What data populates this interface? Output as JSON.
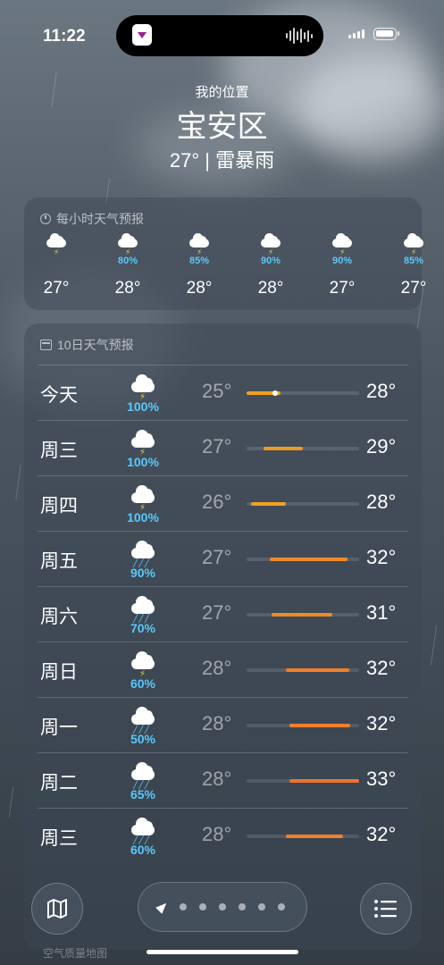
{
  "status": {
    "time": "11:22"
  },
  "header": {
    "subtitle": "我的位置",
    "location": "宝安区",
    "condition": "27° | 雷暴雨"
  },
  "hourly": {
    "title": "每小时天气预报",
    "items": [
      {
        "icon": "cloud-bolt-icon",
        "pct": "",
        "temp": "27°"
      },
      {
        "icon": "cloud-bolt-rain-icon",
        "pct": "80%",
        "temp": "28°"
      },
      {
        "icon": "cloud-bolt-rain-icon",
        "pct": "85%",
        "temp": "28°"
      },
      {
        "icon": "cloud-bolt-rain-icon",
        "pct": "90%",
        "temp": "28°"
      },
      {
        "icon": "cloud-bolt-rain-icon",
        "pct": "90%",
        "temp": "27°"
      },
      {
        "icon": "cloud-bolt-rain-icon",
        "pct": "85%",
        "temp": "27°"
      }
    ]
  },
  "daily": {
    "title": "10日天气预报",
    "days": [
      {
        "name": "今天",
        "icon": "cloud-bolt-rain-icon",
        "pct": "100%",
        "low": "25°",
        "high": "28°",
        "bar_color": "#f0a020",
        "range_start": 0.0,
        "range_end": 0.3,
        "now": 0.25
      },
      {
        "name": "周三",
        "icon": "cloud-bolt-rain-icon",
        "pct": "100%",
        "low": "27°",
        "high": "29°",
        "bar_color": "#f09a22",
        "range_start": 0.15,
        "range_end": 0.5
      },
      {
        "name": "周四",
        "icon": "cloud-bolt-rain-icon",
        "pct": "100%",
        "low": "26°",
        "high": "28°",
        "bar_color": "#f0a020",
        "range_start": 0.04,
        "range_end": 0.35
      },
      {
        "name": "周五",
        "icon": "cloud-rain-icon",
        "pct": "90%",
        "low": "27°",
        "high": "32°",
        "bar_color": "#f08a28",
        "range_start": 0.21,
        "range_end": 0.9
      },
      {
        "name": "周六",
        "icon": "cloud-rain-icon",
        "pct": "70%",
        "low": "27°",
        "high": "31°",
        "bar_color": "#f08a28",
        "range_start": 0.22,
        "range_end": 0.76
      },
      {
        "name": "周日",
        "icon": "cloud-bolt-rain-icon",
        "pct": "60%",
        "low": "28°",
        "high": "32°",
        "bar_color": "#f07f2a",
        "range_start": 0.35,
        "range_end": 0.91
      },
      {
        "name": "周一",
        "icon": "cloud-rain-icon",
        "pct": "50%",
        "low": "28°",
        "high": "32°",
        "bar_color": "#f07f2a",
        "range_start": 0.38,
        "range_end": 0.92
      },
      {
        "name": "周二",
        "icon": "cloud-rain-icon",
        "pct": "65%",
        "low": "28°",
        "high": "33°",
        "bar_color": "#f07030",
        "range_start": 0.38,
        "range_end": 1.0
      },
      {
        "name": "周三",
        "icon": "cloud-rain-icon",
        "pct": "60%",
        "low": "28°",
        "high": "32°",
        "bar_color": "#f07f2a",
        "range_start": 0.35,
        "range_end": 0.86
      }
    ]
  },
  "bottom": {
    "air_quality_label": "空气质量地图"
  }
}
